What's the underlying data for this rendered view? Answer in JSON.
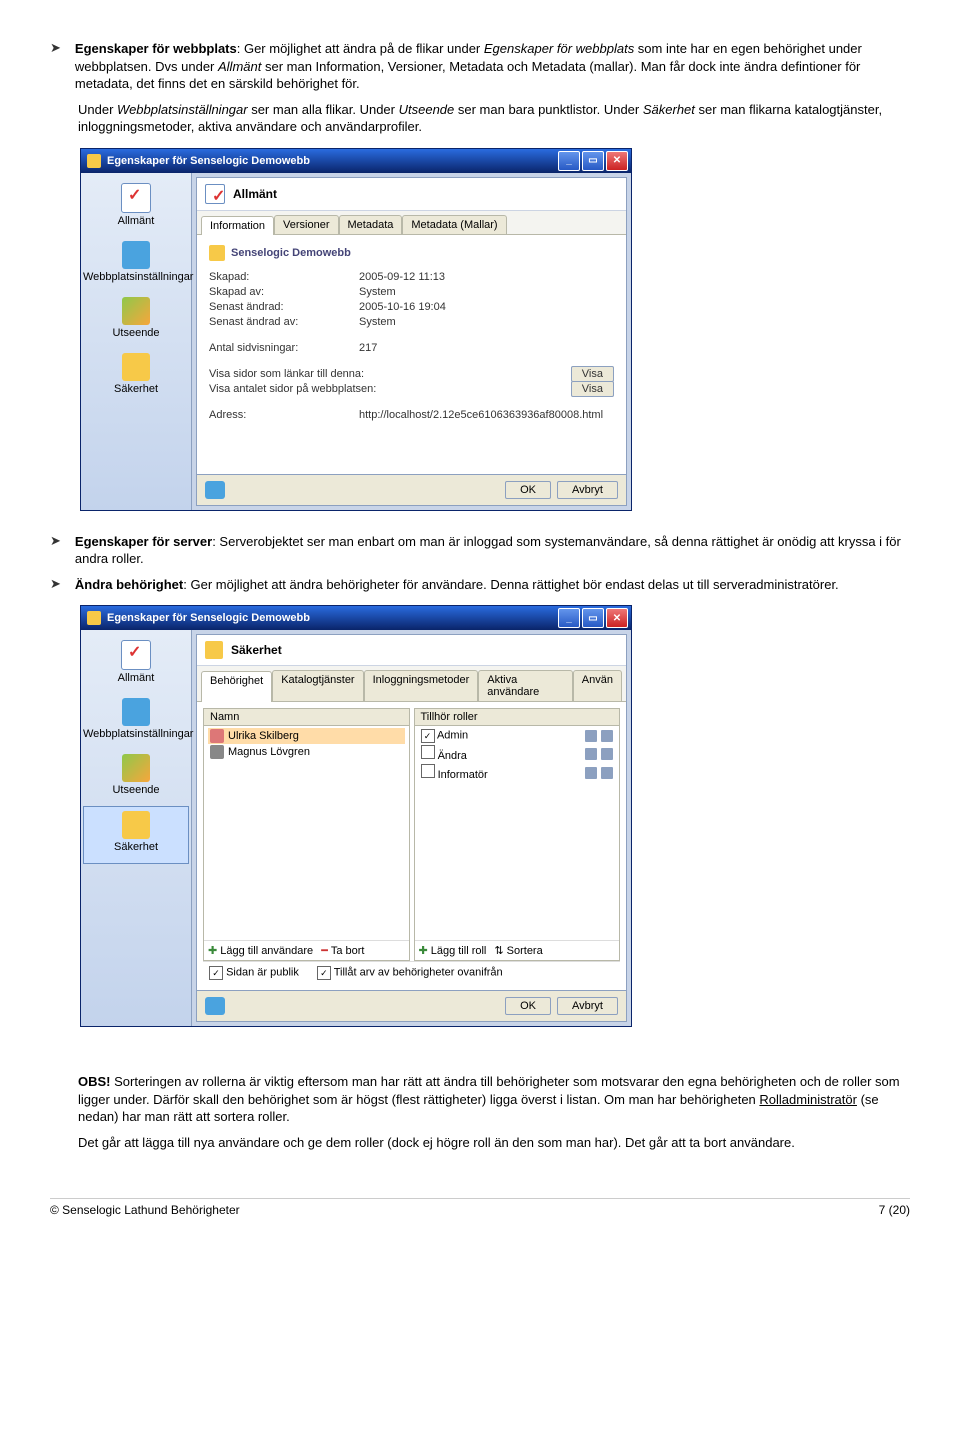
{
  "bullets": {
    "b1": {
      "prefix": "Egenskaper för webbplats",
      "line1a": ": Ger möjlighet att ändra på de flikar under ",
      "italic1": "Egenskaper för webbplats",
      "line1b": " som  inte har en egen behörighet under webbplatsen. Dvs under ",
      "italic2": "Allmänt",
      "line1c": " ser man Information, Versioner, Metadata och Metadata (mallar). Man får dock inte ändra defintioner för metadata, det finns det en särskild behörighet för."
    },
    "p2": {
      "a": "Under ",
      "i1": "Webbplatsinställningar",
      "b": " ser man alla flikar. Under ",
      "i2": "Utseende",
      "c": " ser man bara punktlistor. Under ",
      "i3": "Säkerhet",
      "d": " ser man flikarna katalogtjänster, inloggningsmetoder, aktiva användare och användarprofiler."
    },
    "b2": {
      "prefix": "Egenskaper för server",
      "text": ": Serverobjektet ser man enbart om man är inloggad som systemanvändare, så denna rättighet är onödig att kryssa i för andra roller."
    },
    "b3": {
      "prefix": "Ändra behörighet",
      "text": ": Ger möjlighet att ändra behörigheter för användare. Denna rättighet bör endast delas ut till serveradministratörer."
    }
  },
  "dialog1": {
    "title": "Egenskaper för Senselogic Demowebb",
    "sidebar": [
      "Allmänt",
      "Webbplatsinställningar",
      "Utseende",
      "Säkerhet"
    ],
    "panel_title": "Allmänt",
    "tabs": [
      "Information",
      "Versioner",
      "Metadata",
      "Metadata (Mallar)"
    ],
    "name": "Senselogic Demowebb",
    "rows": [
      {
        "l": "Skapad:",
        "v": "2005-09-12 11:13"
      },
      {
        "l": "Skapad av:",
        "v": "System"
      },
      {
        "l": "Senast ändrad:",
        "v": "2005-10-16 19:04"
      },
      {
        "l": "Senast ändrad av:",
        "v": "System"
      }
    ],
    "views_label": "Antal sidvisningar:",
    "views_value": "217",
    "linkrow1": "Visa sidor som länkar till denna:",
    "linkrow2": "Visa antalet sidor på webbplatsen:",
    "visa": "Visa",
    "addr_label": "Adress:",
    "addr_value": "http://localhost/2.12e5ce6106363936af80008.html",
    "ok": "OK",
    "cancel": "Avbryt"
  },
  "dialog2": {
    "title": "Egenskaper för Senselogic Demowebb",
    "sidebar": [
      "Allmänt",
      "Webbplatsinställningar",
      "Utseende",
      "Säkerhet"
    ],
    "panel_title": "Säkerhet",
    "tabs": [
      "Behörighet",
      "Katalogtjänster",
      "Inloggningsmetoder",
      "Aktiva användare",
      "Använ"
    ],
    "col_name": "Namn",
    "col_role": "Tillhör roller",
    "users": [
      {
        "n": "Ulrika Skilberg",
        "sel": true
      },
      {
        "n": "Magnus Lövgren",
        "sel": false
      }
    ],
    "roles": [
      {
        "n": "Admin",
        "c": true
      },
      {
        "n": "Ändra",
        "c": false
      },
      {
        "n": "Informatör",
        "c": false
      }
    ],
    "add_user": "Lägg till användare",
    "remove": "Ta bort",
    "add_role": "Lägg till roll",
    "sort": "Sortera",
    "foot1": "Sidan är publik",
    "foot2": "Tillåt arv av behörigheter ovanifrån",
    "ok": "OK",
    "cancel": "Avbryt"
  },
  "obs": {
    "label": "OBS!",
    "text": " Sorteringen av rollerna är viktig eftersom man har rätt att ändra till behörigheter som motsvarar den egna behörigheten och de roller som ligger under. Därför skall den behörighet som är högst (flest rättigheter) ligga överst i listan. Om man har behörigheten ",
    "u": "Rolladministratör",
    "text2": " (se nedan) har man rätt att sortera roller.",
    "p2": "Det går att lägga till nya användare och ge dem roller (dock ej högre roll än den som man har). Det går att ta bort användare."
  },
  "footer": {
    "left": "© Senselogic Lathund Behörigheter",
    "right": "7 (20)"
  }
}
